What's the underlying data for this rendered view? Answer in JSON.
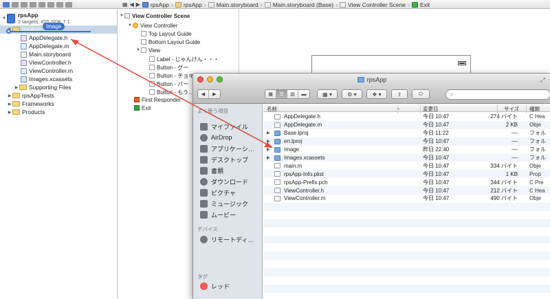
{
  "jump_bar": {
    "crumbs": [
      "rpsApp",
      "rpsApp",
      "Main.storyboard",
      "Main.storyboard (Base)",
      "View Controller Scene",
      "Exit"
    ]
  },
  "navigator": {
    "project_name": "rpsApp",
    "project_subtitle": "2 targets, iOS SDK 7.1",
    "selected_group": "rpsApp",
    "drag_label": "Image",
    "files": [
      "AppDelegate.h",
      "AppDelegate.m",
      "Main.storyboard",
      "ViewController.h",
      "ViewController.m",
      "Images.xcassets",
      "Supporting Files"
    ],
    "groups": [
      "rpsAppTests",
      "Frameworks",
      "Products"
    ]
  },
  "outline": {
    "scene": "View Controller Scene",
    "view_controller": "View Controller",
    "top_guide": "Top Layout Guide",
    "bottom_guide": "Bottom Layout Guide",
    "view": "View",
    "children": [
      "Label - じゃんけん・・・",
      "Button - グー",
      "Button - チョキ",
      "Button - パー",
      "Button - もう…"
    ],
    "first_responder": "First Responder",
    "exit": "Exit"
  },
  "finder": {
    "title": "rpsApp",
    "search_placeholder": "",
    "sidebar": {
      "favorites_header": "よく使う項目",
      "favorites": [
        {
          "label": "マイファイル",
          "icon": "all-my-files-icon"
        },
        {
          "label": "AirDrop",
          "icon": "airdrop-icon"
        },
        {
          "label": "アプリケーシ…",
          "icon": "applications-icon"
        },
        {
          "label": "デスクトップ",
          "icon": "desktop-icon"
        },
        {
          "label": "書類",
          "icon": "documents-icon"
        },
        {
          "label": "ダウンロード",
          "icon": "downloads-icon"
        },
        {
          "label": "ピクチャ",
          "icon": "pictures-icon"
        },
        {
          "label": "ミュージック",
          "icon": "music-icon"
        },
        {
          "label": "ムービー",
          "icon": "movies-icon"
        }
      ],
      "devices_header": "デバイス",
      "devices": [
        {
          "label": "リモートディ…",
          "icon": "remote-disc-icon"
        }
      ],
      "tags_header": "タグ",
      "tags": [
        {
          "label": "レッド",
          "icon": "red-tag-icon"
        }
      ]
    },
    "columns": {
      "name": "名前",
      "date": "変更日",
      "size": "サイズ",
      "kind": "種類"
    },
    "rows": [
      {
        "name": "AppDelegate.h",
        "date": "今日 10:47",
        "size": "274 バイト",
        "kind": "C Hea",
        "folder": false
      },
      {
        "name": "AppDelegate.m",
        "date": "今日 10:47",
        "size": "2 KB",
        "kind": "Obje",
        "folder": false
      },
      {
        "name": "Base.lproj",
        "date": "今日 11:22",
        "size": "––",
        "kind": "フォル",
        "folder": true
      },
      {
        "name": "en.lproj",
        "date": "今日 10:47",
        "size": "––",
        "kind": "フォル",
        "folder": true
      },
      {
        "name": "Image",
        "date": "昨日 22:40",
        "size": "––",
        "kind": "フォル",
        "folder": true
      },
      {
        "name": "Images.xcassets",
        "date": "今日 10:47",
        "size": "––",
        "kind": "フォル",
        "folder": true
      },
      {
        "name": "main.m",
        "date": "今日 10:47",
        "size": "334 バイト",
        "kind": "Obje",
        "folder": false
      },
      {
        "name": "rpsApp-Info.plist",
        "date": "今日 10:47",
        "size": "1 KB",
        "kind": "Prop",
        "folder": false
      },
      {
        "name": "rpsApp-Prefix.pch",
        "date": "今日 10:47",
        "size": "344 バイト",
        "kind": "C Pre",
        "folder": false
      },
      {
        "name": "ViewController.h",
        "date": "今日 10:47",
        "size": "212 バイト",
        "kind": "C Hea",
        "folder": false
      },
      {
        "name": "ViewController.m",
        "date": "今日 10:47",
        "size": "490 バイト",
        "kind": "Obje",
        "folder": false
      }
    ]
  },
  "colors": {
    "selection": "#3d72c8",
    "drag_arrow": "#e04b3a",
    "sidebar_bg": "#dee4ea"
  }
}
